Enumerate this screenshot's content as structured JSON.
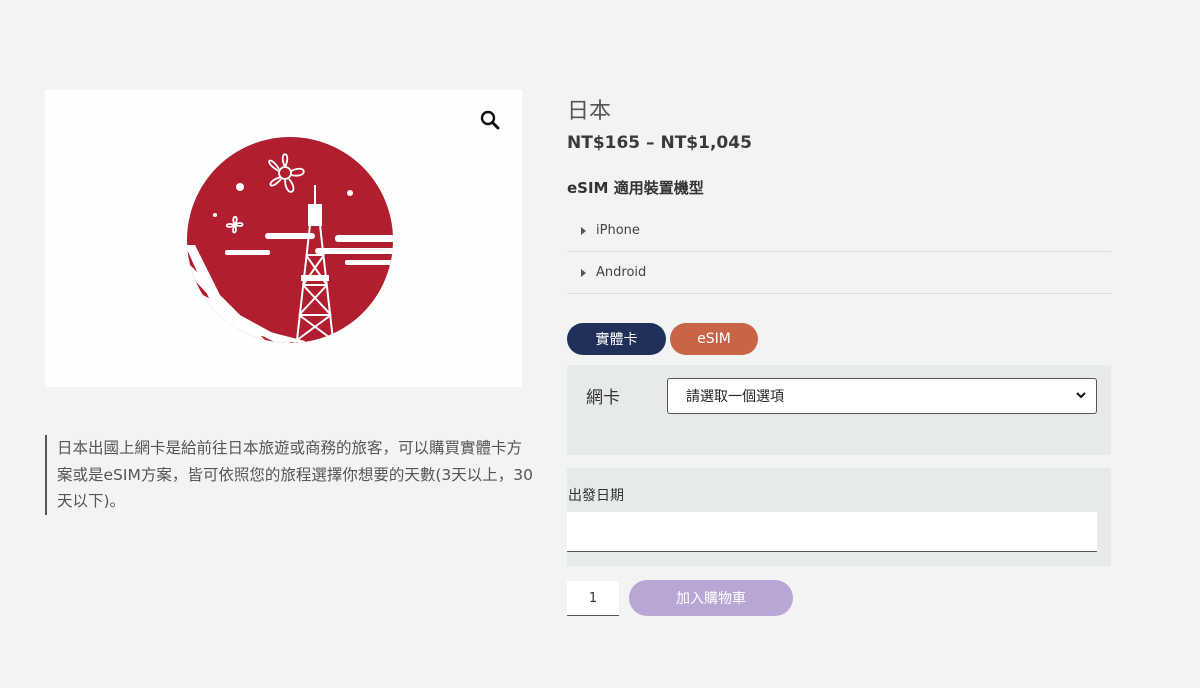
{
  "product": {
    "title": "日本",
    "price_range": "NT$165 – NT$1,045",
    "device_heading": "eSIM 適用裝置機型",
    "description": "日本出國上網卡是給前往日本旅遊或商務的旅客，可以購買實體卡方案或是eSIM方案，皆可依照您的旅程選擇你想要的天數(3天以上，30天以下)。"
  },
  "accordion": [
    {
      "label": "iPhone"
    },
    {
      "label": "Android"
    }
  ],
  "tabs": [
    {
      "label": "實體卡",
      "color": "#21305a"
    },
    {
      "label": "eSIM",
      "color": "#c96446"
    }
  ],
  "card_option": {
    "label": "網卡",
    "selected": "請選取一個選項"
  },
  "departure": {
    "label": "出發日期",
    "value": ""
  },
  "cart": {
    "quantity": "1",
    "add_label": "加入購物車",
    "button_color": "#b9a6d4"
  },
  "icons": {
    "zoom": "magnifier-icon",
    "dropdown": "chevron-down-icon",
    "accordion": "triangle-right-icon"
  },
  "colors": {
    "background": "#f2f4f3",
    "japan_red": "#b01e2f"
  }
}
